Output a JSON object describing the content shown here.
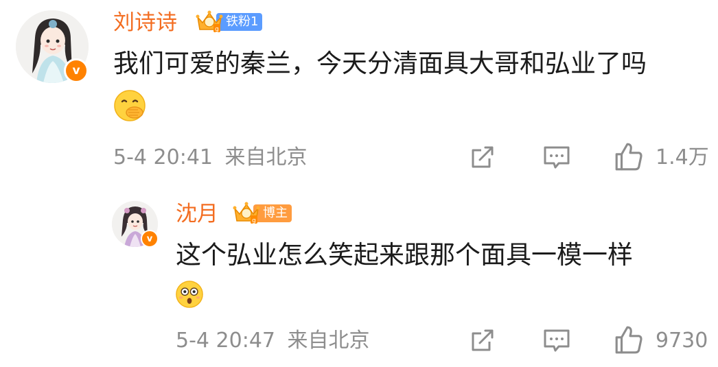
{
  "comments": [
    {
      "author": "刘诗诗",
      "badge": "铁粉1",
      "text": "我们可爱的秦兰，今天分清面具大哥和弘业了吗",
      "emoji": "hand-over-mouth-emoji",
      "time": "5-4 20:41",
      "location": "来自北京",
      "likes": "1.4万"
    },
    {
      "author": "沈月",
      "badge": "博主",
      "text": "这个弘业怎么笑起来跟那个面具一模一样",
      "emoji": "shocked-face-emoji",
      "time": "5-4 20:47",
      "location": "来自北京",
      "likes": "9730"
    }
  ],
  "verified_mark": "v",
  "colors": {
    "name": "#f36d21",
    "meta": "#8d8d8d",
    "verified": "#ff8200",
    "fan_badge": "#5b9cff",
    "blogger_badge": "#ff9c3f"
  },
  "icons": [
    "share-icon",
    "comment-icon",
    "like-icon",
    "crown-badge-icon"
  ]
}
